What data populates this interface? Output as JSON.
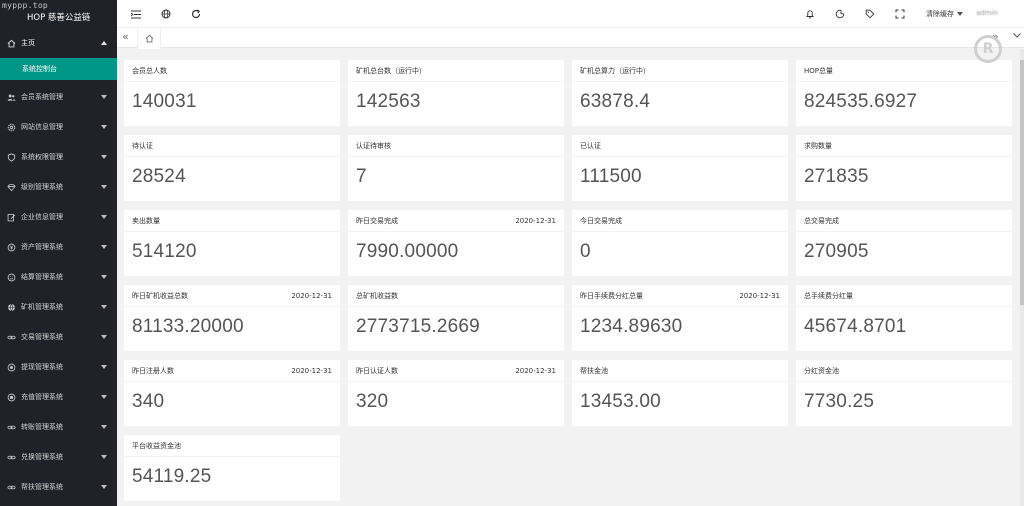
{
  "watermark": "myppp.top",
  "app": {
    "logo_text": "HOP 慈善公益链"
  },
  "sidebar": {
    "home": {
      "label": "主页",
      "icon": "home-icon"
    },
    "active_sub": {
      "label": "系统控制台"
    },
    "items": [
      {
        "label": "会员系统管理",
        "icon": "users-icon"
      },
      {
        "label": "网站信息管理",
        "icon": "settings-icon"
      },
      {
        "label": "系统权限管理",
        "icon": "shield-icon"
      },
      {
        "label": "级别管理系统",
        "icon": "diamond-icon"
      },
      {
        "label": "企业信息管理",
        "icon": "edit-icon"
      },
      {
        "label": "资产管理系统",
        "icon": "money-icon"
      },
      {
        "label": "结算管理系统",
        "icon": "smile-icon"
      },
      {
        "label": "矿机管理系统",
        "icon": "globe-icon"
      },
      {
        "label": "交易管理系统",
        "icon": "link-icon"
      },
      {
        "label": "提现管理系统",
        "icon": "target-icon"
      },
      {
        "label": "充值管理系统",
        "icon": "wallet-icon"
      },
      {
        "label": "转账管理系统",
        "icon": "link-icon"
      },
      {
        "label": "兑换管理系统",
        "icon": "link-icon"
      },
      {
        "label": "帮扶管理系统",
        "icon": "link-icon"
      }
    ]
  },
  "header": {
    "clear_cache": "清除缓存",
    "username": "admin"
  },
  "cards": [
    {
      "title": "会员总人数",
      "date": "",
      "value": "140031"
    },
    {
      "title": "矿机总台数（运行中）",
      "date": "",
      "value": "142563"
    },
    {
      "title": "矿机总算力（运行中）",
      "date": "",
      "value": "63878.4"
    },
    {
      "title": "HOP总量",
      "date": "",
      "value": "824535.6927"
    },
    {
      "title": "待认证",
      "date": "",
      "value": "28524"
    },
    {
      "title": "认证待审核",
      "date": "",
      "value": "7"
    },
    {
      "title": "已认证",
      "date": "",
      "value": "111500"
    },
    {
      "title": "求购数量",
      "date": "",
      "value": "271835"
    },
    {
      "title": "卖出数量",
      "date": "",
      "value": "514120"
    },
    {
      "title": "昨日交易完成",
      "date": "2020-12-31",
      "value": "7990.00000"
    },
    {
      "title": "今日交易完成",
      "date": "",
      "value": "0"
    },
    {
      "title": "总交易完成",
      "date": "",
      "value": "270905"
    },
    {
      "title": "昨日矿机收益总数",
      "date": "2020-12-31",
      "value": "81133.20000"
    },
    {
      "title": "总矿机收益数",
      "date": "",
      "value": "2773715.2669"
    },
    {
      "title": "昨日手续费分红总量",
      "date": "2020-12-31",
      "value": "1234.89630"
    },
    {
      "title": "总手续费分红量",
      "date": "",
      "value": "45674.8701"
    },
    {
      "title": "昨日注册人数",
      "date": "2020-12-31",
      "value": "340"
    },
    {
      "title": "昨日认证人数",
      "date": "2020-12-31",
      "value": "320"
    },
    {
      "title": "帮扶金池",
      "date": "",
      "value": "13453.00"
    },
    {
      "title": "分红资金池",
      "date": "",
      "value": "7730.25"
    },
    {
      "title": "平台收益资金池",
      "date": "",
      "value": "54119.25"
    }
  ],
  "colors": {
    "sidebar_bg": "#20222a",
    "accent": "#009688",
    "content_bg": "#f2f2f2"
  }
}
